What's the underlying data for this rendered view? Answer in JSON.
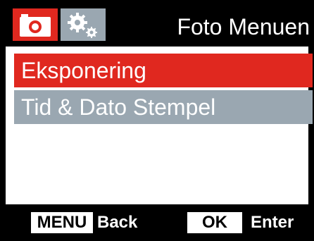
{
  "header": {
    "title": "Foto Menuen",
    "tabs": [
      {
        "icon": "camera-icon",
        "active": true
      },
      {
        "icon": "settings-gears-icon",
        "active": false
      }
    ]
  },
  "menu": {
    "items": [
      {
        "label": "Eksponering",
        "selected": true
      },
      {
        "label": "Tid & Dato Stempel",
        "selected": false
      }
    ]
  },
  "footer": {
    "menu_key": "MENU",
    "menu_action": "Back",
    "ok_key": "OK",
    "ok_action": "Enter"
  },
  "colors": {
    "accent": "#e0281f",
    "inactive": "#9aa7b1",
    "background": "#000000",
    "text": "#ffffff"
  }
}
